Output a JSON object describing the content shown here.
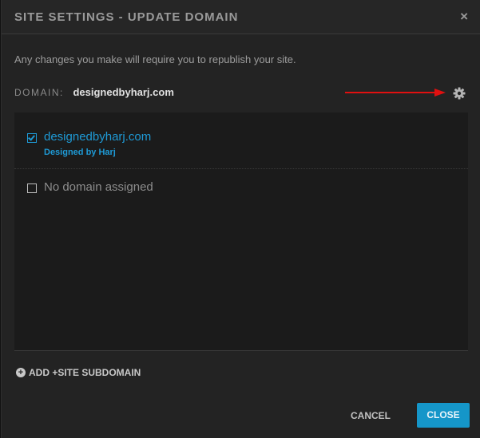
{
  "dialog": {
    "title": "SITE SETTINGS - UPDATE DOMAIN",
    "close_icon": "×",
    "notice": "Any changes you make will require you to republish your site.",
    "domain_label": "DOMAIN:",
    "domain_value": "designedbyharj.com"
  },
  "colors": {
    "accent": "#1596c9",
    "link": "#1e9ad6",
    "annotation_arrow": "#e01010"
  },
  "domains": [
    {
      "name": "designedbyharj.com",
      "subtitle": "Designed by Harj",
      "checked": true
    },
    {
      "name": "No domain assigned",
      "subtitle": "",
      "checked": false
    }
  ],
  "actions": {
    "add_subdomain": "ADD +SITE SUBDOMAIN",
    "cancel": "CANCEL",
    "close": "CLOSE"
  }
}
